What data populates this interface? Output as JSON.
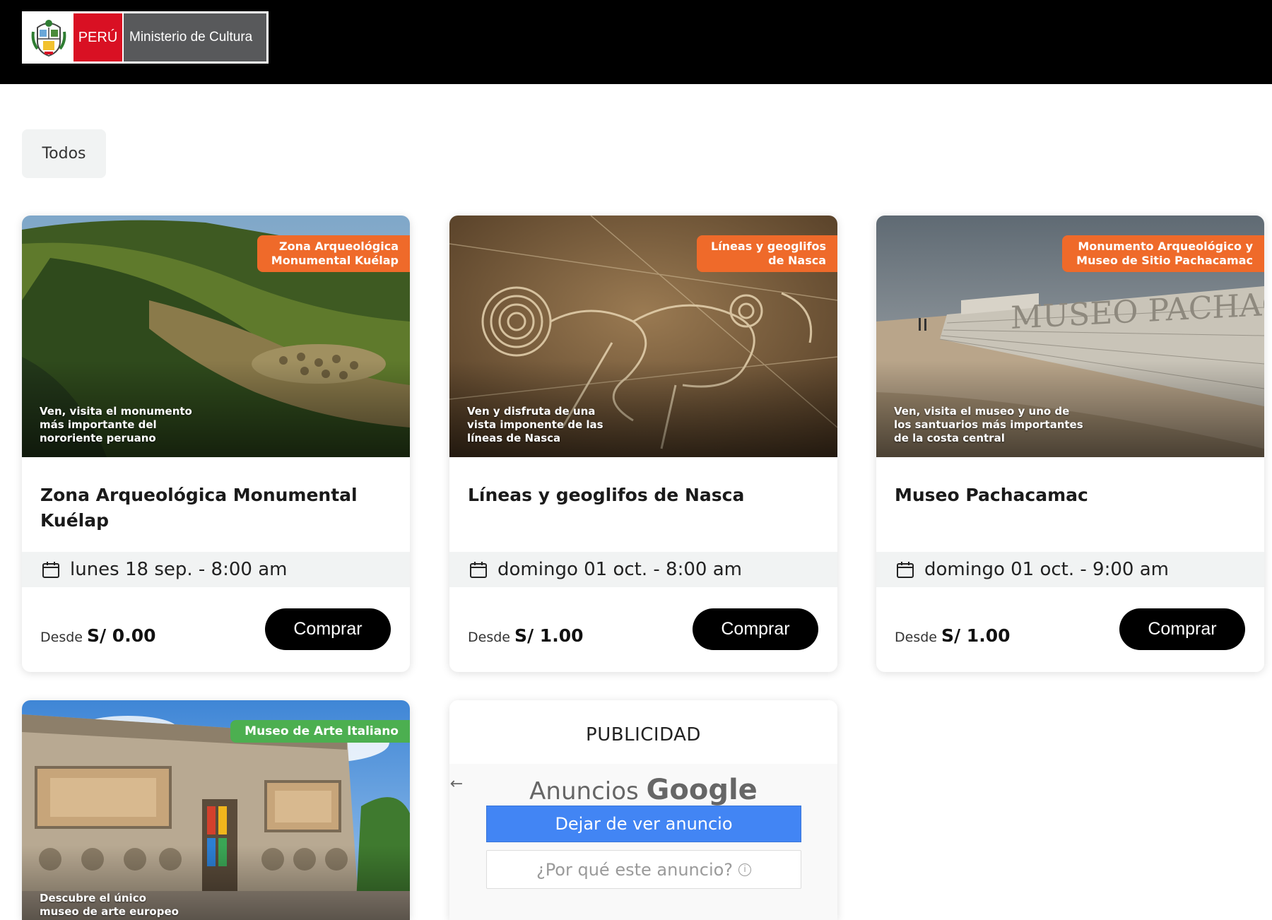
{
  "header": {
    "logo": {
      "country": "PERÚ",
      "ministry": "Ministerio de Cultura"
    }
  },
  "filters": {
    "active": "Todos"
  },
  "events": [
    {
      "tag": "Zona Arqueológica\nMonumental Kuélap",
      "caption": "Ven, visita el monumento\nmás importante del\nnororiente peruano",
      "title": "Zona Arqueológica Monumental Kuélap",
      "date": "lunes 18 sep. - 8:00 am",
      "from_label": "Desde",
      "price": "S/ 0.00",
      "buy_label": "Comprar"
    },
    {
      "tag": "Líneas y geoglifos\nde Nasca",
      "caption": "Ven y disfruta de una\nvista imponente de las\nlíneas de Nasca",
      "title": "Líneas y geoglifos de Nasca",
      "date": "domingo 01 oct. - 8:00 am",
      "from_label": "Desde",
      "price": "S/ 1.00",
      "buy_label": "Comprar"
    },
    {
      "tag": "Monumento Arqueológico y\nMuseo de Sitio Pachacamac",
      "caption": "Ven, visita el museo y uno de\nlos santuarios más importantes\nde la costa central",
      "title": "Museo Pachacamac",
      "date": "domingo 01 oct. - 9:00 am",
      "from_label": "Desde",
      "price": "S/ 1.00",
      "buy_label": "Comprar"
    },
    {
      "tag": "Museo de Arte Italiano",
      "caption": "Descubre el único\nmuseo de arte europeo"
    }
  ],
  "ad": {
    "heading": "PUBLICIDAD",
    "anuncios": "Anuncios",
    "google": "Google",
    "stop_label": "Dejar de ver anuncio",
    "why_label": "¿Por qué este anuncio?",
    "info_glyph": "i",
    "back_glyph": "←"
  },
  "colors": {
    "tag_orange": "#ef6a2a",
    "tag_green": "#4caf50",
    "peru_red": "#d91023",
    "ad_blue": "#4285f4"
  }
}
